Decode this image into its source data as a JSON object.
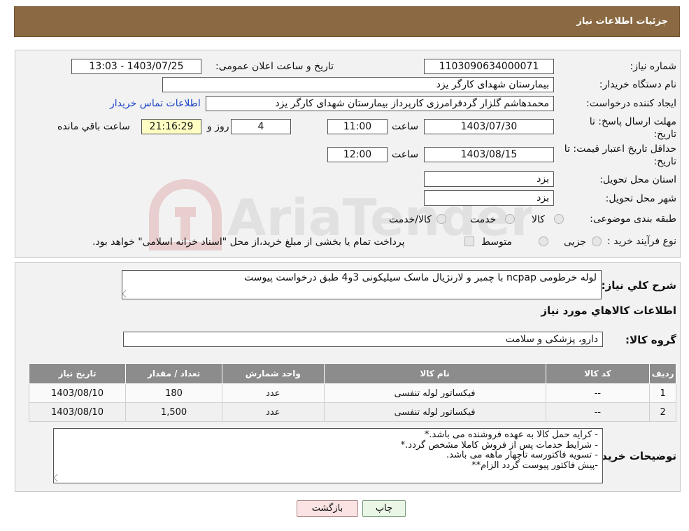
{
  "header": {
    "title": "جزئیات اطلاعات نیاز"
  },
  "form": {
    "need_number": {
      "label": "شماره نیاز:",
      "value": "1103090634000071"
    },
    "announce": {
      "label": "تاریخ و ساعت اعلان عمومی:",
      "value": "1403/07/25 - 13:03"
    },
    "buyer_org": {
      "label": "نام دستگاه خریدار:",
      "value": "بیمارستان شهدای کارگر یزد"
    },
    "requester": {
      "label": "ایجاد کننده درخواست:",
      "value": "محمدهاشم گلزار گردفرامرزی کارپرداز بیمارستان شهدای کارگر یزد",
      "contact_link": "اطلاعات تماس خریدار"
    },
    "reply_deadline": {
      "label_line1": "مهلت ارسال پاسخ: تا",
      "label_line2": "تاریخ:",
      "date": "1403/07/30",
      "time_label": "ساعت",
      "time": "11:00",
      "days": "4",
      "days_label": "روز و",
      "remaining": "21:16:29",
      "remaining_label": "ساعت باقي مانده"
    },
    "price_validity": {
      "label_line1": "حداقل تاریخ اعتبار قیمت: تا",
      "label_line2": "تاریخ:",
      "date": "1403/08/15",
      "time_label": "ساعت",
      "time": "12:00"
    },
    "province": {
      "label": "استان محل تحویل:",
      "value": "یزد"
    },
    "city": {
      "label": "شهر محل تحویل:",
      "value": "یزد"
    },
    "category": {
      "label": "طبقه بندی موضوعی:",
      "options": [
        "کالا",
        "خدمت",
        "کالا/خدمت"
      ]
    },
    "process": {
      "label": "نوع فرآیند خرید :",
      "options": [
        "جزیی",
        "متوسط"
      ],
      "note": "پرداخت تمام یا بخشی از مبلغ خرید،از محل \"اسناد خزانه اسلامی\" خواهد بود."
    }
  },
  "details": {
    "summary_label": "شرح کلي نياز:",
    "summary": "لوله خرطومی ncpap با چمبر و لارنژیال ماسک سیلیکونی 3و4 طبق درخواست پیوست",
    "goods_info_title": "اطلاعات کالاهاي مورد نياز",
    "group_label": "گروه کالا:",
    "group_value": "دارو، پزشکی و سلامت"
  },
  "table": {
    "headers": [
      "ردیف",
      "کد کالا",
      "نام کالا",
      "واحد شمارش",
      "تعداد / مقدار",
      "تاریخ نیاز"
    ],
    "rows": [
      [
        "1",
        "--",
        "فیکساتور لوله تنفسی",
        "عدد",
        "180",
        "1403/08/10"
      ],
      [
        "2",
        "--",
        "فیکساتور لوله تنفسی",
        "عدد",
        "1,500",
        "1403/08/10"
      ]
    ]
  },
  "buyer_notes": {
    "label": "توضیحات خریدار:",
    "lines": [
      "- کرایه حمل  کالا به عهده فروشنده می باشد.*",
      "- شرایط خدمات پس از فروش کاملا مشخص گردد.*",
      "- تسویه فاکتورسه تاچهار ماهه می باشد.",
      "-پیش فاکتور پیوست گردد  الزام**"
    ]
  },
  "buttons": {
    "print": "چاپ",
    "back": "بازگشت"
  },
  "watermark": {
    "text": "AriaTender.neT"
  }
}
